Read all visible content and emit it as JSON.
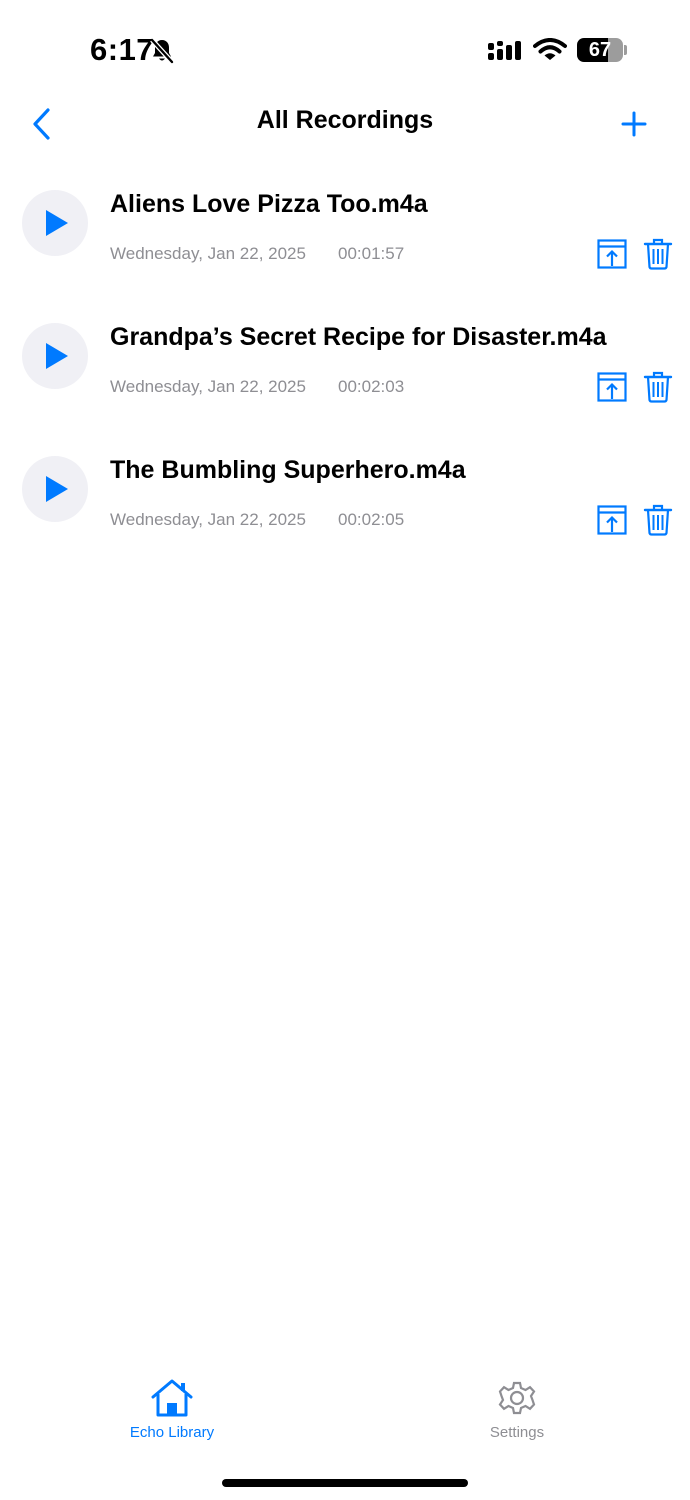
{
  "status_bar": {
    "time": "6:17",
    "battery_level": "67",
    "icons": [
      "bell-slash-icon",
      "cellular-signal-icon",
      "wifi-icon",
      "battery-icon"
    ]
  },
  "nav": {
    "title": "All Recordings",
    "back_icon": "chevron-left-icon",
    "add_icon": "plus-icon"
  },
  "recordings": [
    {
      "title": "Aliens Love Pizza Too.m4a",
      "date": "Wednesday, Jan 22, 2025",
      "duration": "00:01:57"
    },
    {
      "title": "Grandpa’s Secret Recipe for Disaster.m4a",
      "date": "Wednesday, Jan 22, 2025",
      "duration": "00:02:03"
    },
    {
      "title": "The Bumbling Superhero.m4a",
      "date": "Wednesday, Jan 22, 2025",
      "duration": "00:02:05"
    }
  ],
  "row_icons": [
    "play-icon",
    "share-icon",
    "trash-icon"
  ],
  "tab_bar": {
    "tabs": [
      {
        "label": "Echo Library",
        "icon": "house-icon",
        "active": true
      },
      {
        "label": "Settings",
        "icon": "gear-icon",
        "active": false
      }
    ]
  },
  "colors": {
    "accent": "#007aff",
    "secondary_text": "#8e8e93",
    "play_button_bg": "#f0f0f5"
  }
}
